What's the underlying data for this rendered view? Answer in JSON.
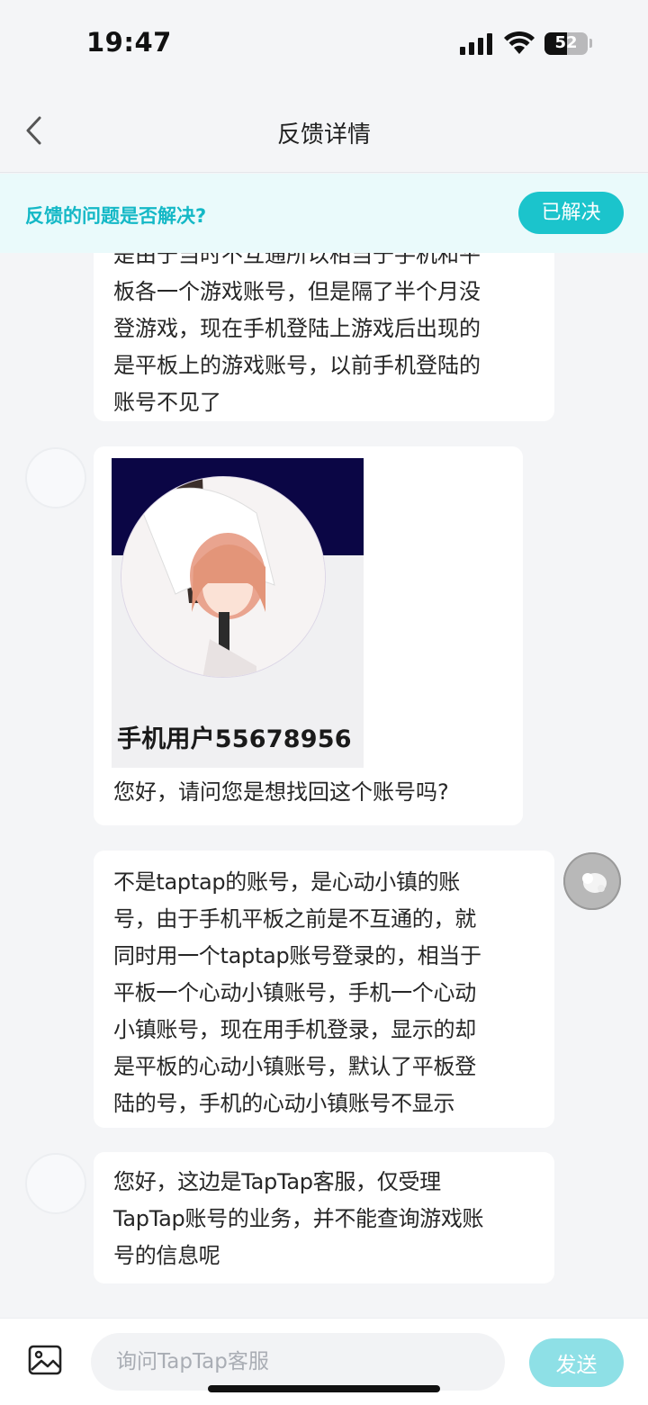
{
  "status_bar": {
    "time": "19:47",
    "battery_level": "52",
    "battery_fraction": 0.52
  },
  "nav": {
    "title": "反馈详情",
    "back_icon": "chevron-left-icon"
  },
  "resolve_banner": {
    "question": "反馈的问题是否解决?",
    "button_label": "已解决"
  },
  "colors": {
    "accent": "#1bc4cc",
    "accent_text": "#14b8c6",
    "banner_bg": "#eafafb",
    "send_disabled": "#8ee0e6"
  },
  "messages": [
    {
      "sender": "user",
      "text": "是由于当时不互通所以相当于手机和平板各一个游戏账号，但是隔了半个月没登游戏，现在手机登陆上游戏后出现的是平板上的游戏账号，以前手机登陆的账号不见了",
      "visible_lines": [
        "是由于当时不互通所以相当于手机和平",
        "板各一个游戏账号，但是隔了半个月没",
        "登游戏，现在手机登陆上游戏后出现的",
        "是平板上的游戏账号，以前手机登陆的",
        "账号不见了"
      ]
    },
    {
      "sender": "agent",
      "image_caption": "手机用户55678956",
      "text": "您好，请问您是想找回这个账号吗?"
    },
    {
      "sender": "user",
      "text": "不是taptap的账号，是心动小镇的账\n号，由于手机平板之前是不互通的，就\n同时用一个taptap账号登录的，相当于\n平板一个心动小镇账号，手机一个心动\n小镇账号，现在用手机登录，显示的却\n是平板的心动小镇账号，默认了平板登\n陆的号，手机的心动小镇账号不显示"
    },
    {
      "sender": "agent",
      "text": "您好，这边是TapTap客服，仅受理\nTapTap账号的业务，并不能查询游戏账\n号的信息呢"
    }
  ],
  "input_bar": {
    "image_icon": "image-icon",
    "placeholder": "询问TapTap客服",
    "send_label": "发送"
  }
}
